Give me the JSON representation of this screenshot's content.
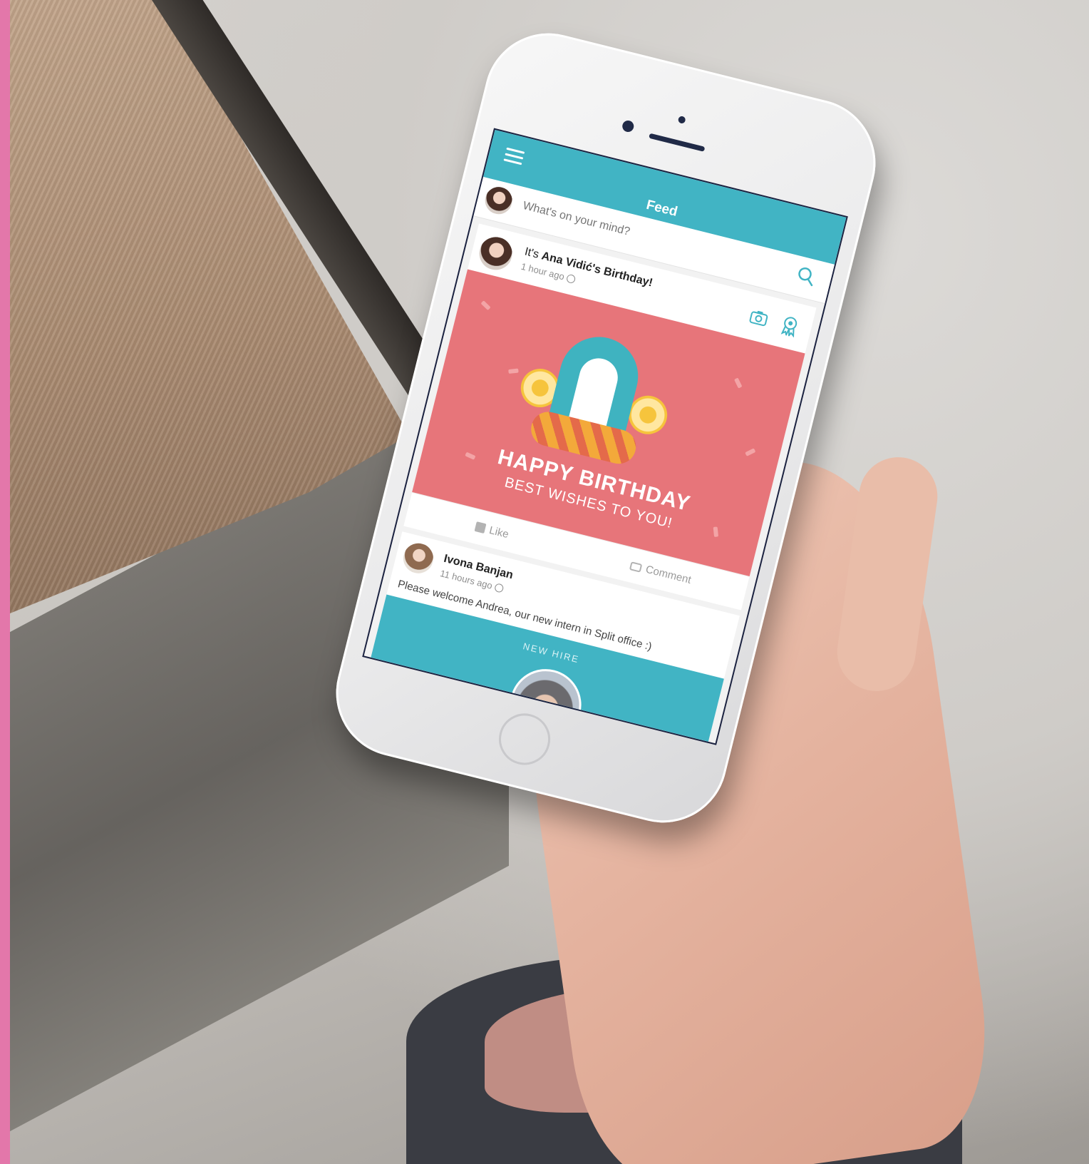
{
  "app": {
    "topbar": {
      "title": "Feed"
    },
    "composer": {
      "placeholder": "What's on your mind?"
    },
    "posts": [
      {
        "title_prefix": "It's ",
        "title_name": "Ana Vidić's Birthday!",
        "time": "1 hour ago",
        "banner": {
          "line1": "HAPPY BIRTHDAY",
          "line2": "BEST WISHES TO YOU!"
        },
        "actions": {
          "like": "Like",
          "comment": "Comment"
        }
      },
      {
        "author": "Ivona Banjan",
        "time": "11 hours ago",
        "body": "Please welcome Andrea, our new intern in Split office :)",
        "card_label": "NEW HIRE"
      }
    ]
  },
  "colors": {
    "accent": "#41b4c4",
    "banner": "#e7757a",
    "side_strip": "#e377aa"
  },
  "icons": [
    "menu-icon",
    "search-icon",
    "camera-icon",
    "award-icon",
    "globe-icon",
    "like-icon",
    "comment-icon"
  ]
}
